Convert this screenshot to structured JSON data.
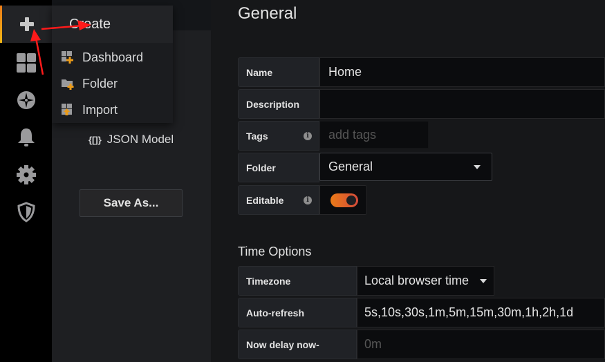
{
  "sidebar": {
    "items": [
      {
        "icon": "plus-icon",
        "active": true
      },
      {
        "icon": "dashboards-icon"
      },
      {
        "icon": "explore-compass-icon"
      },
      {
        "icon": "bell-icon"
      },
      {
        "icon": "gear-icon"
      },
      {
        "icon": "shield-icon"
      }
    ]
  },
  "create_menu": {
    "title": "Create",
    "items": [
      {
        "label": "Dashboard",
        "icon": "dashboard-add-icon"
      },
      {
        "label": "Folder",
        "icon": "folder-add-icon"
      },
      {
        "label": "Import",
        "icon": "import-icon"
      }
    ]
  },
  "settings_nav": {
    "json_model_icon": "{[]}",
    "json_model": "JSON Model",
    "save_as": "Save As..."
  },
  "main": {
    "title": "General",
    "name": {
      "label": "Name",
      "value": "Home"
    },
    "description": {
      "label": "Description",
      "value": ""
    },
    "tags": {
      "label": "Tags",
      "placeholder": "add tags"
    },
    "folder": {
      "label": "Folder",
      "value": "General"
    },
    "editable": {
      "label": "Editable",
      "on": true
    },
    "time_options": {
      "title": "Time Options",
      "timezone": {
        "label": "Timezone",
        "value": "Local browser time"
      },
      "auto_refresh": {
        "label": "Auto-refresh",
        "value": "5s,10s,30s,1m,5m,15m,30m,1h,2h,1d"
      },
      "now_delay": {
        "label": "Now delay now-",
        "placeholder": "0m"
      }
    }
  },
  "colors": {
    "accent": "#eb7b18",
    "annotation_arrow": "#ff1a1a"
  }
}
